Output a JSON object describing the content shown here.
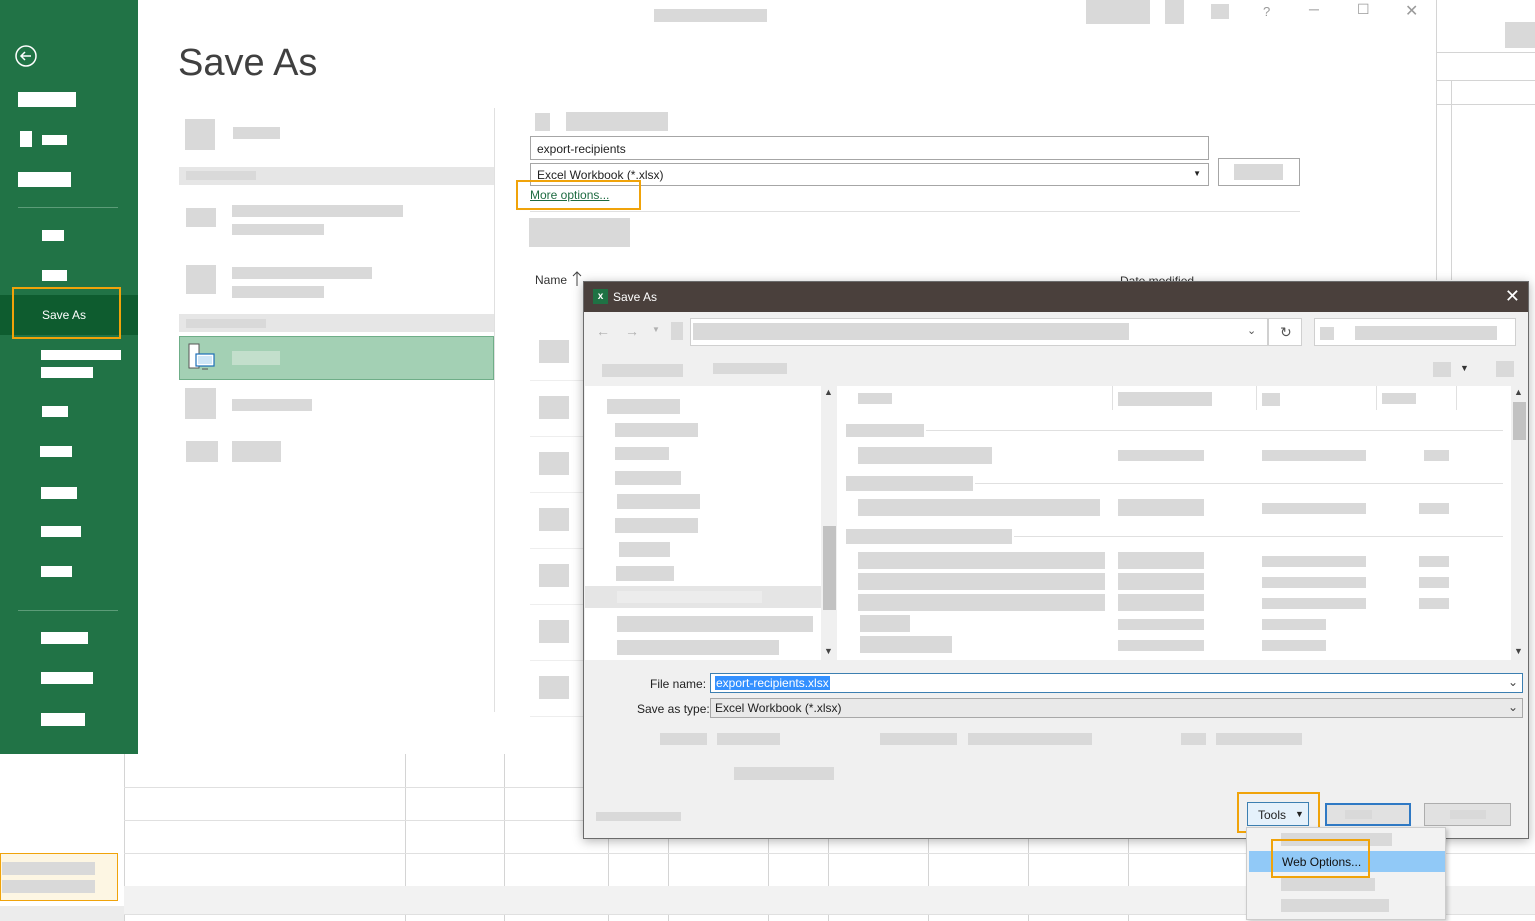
{
  "backstage": {
    "title": "Save As",
    "nav_selected": "Save As"
  },
  "save_panel": {
    "file_name_value": "export-recipients",
    "file_type_value": "Excel Workbook (*.xlsx)",
    "more_options_label": "More options...",
    "name_column_label": "Name",
    "date_modified_label": "Date modified"
  },
  "dialog": {
    "title": "Save As",
    "file_name_label": "File name:",
    "file_name_value": "export-recipients.xlsx",
    "save_type_label": "Save as type:",
    "save_type_value": "Excel Workbook (*.xlsx)",
    "tools_label": "Tools",
    "tools_menu": {
      "highlighted_item": "Web Options..."
    }
  },
  "colors": {
    "backstage_green": "#217346",
    "selected_location": "#a3d0b4",
    "highlight_box": "#f0a30a",
    "dialog_titlebar": "#4a403c",
    "menu_highlight": "#91c9f7"
  },
  "icons": {
    "back": "back-arrow-icon",
    "excel": "excel-icon",
    "sort": "sort-up-icon",
    "close": "close-icon",
    "refresh": "refresh-icon",
    "dropdown": "chevron-down-icon"
  }
}
